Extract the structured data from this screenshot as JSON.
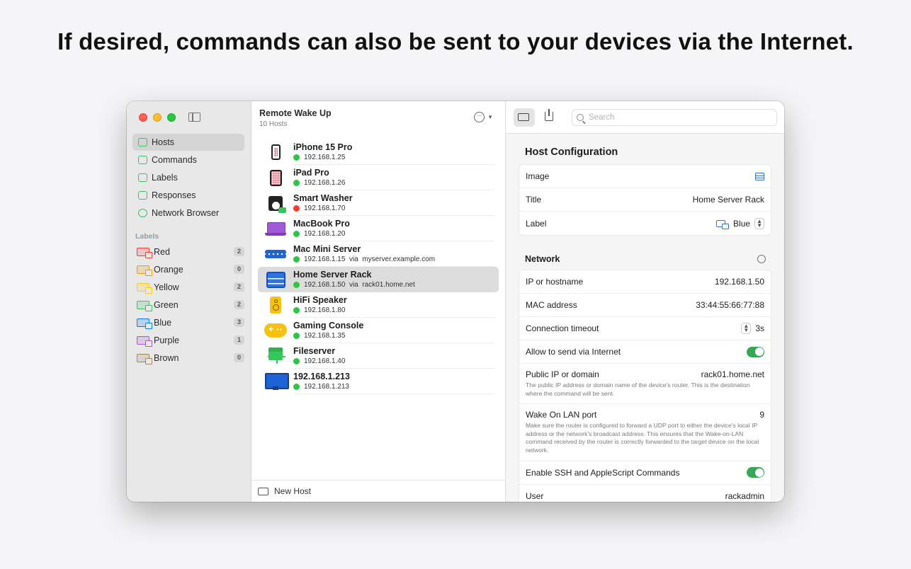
{
  "headline": "If desired, commands can also be sent to your devices via the Internet.",
  "sidebar": {
    "nav": [
      {
        "label": "Hosts",
        "active": true
      },
      {
        "label": "Commands"
      },
      {
        "label": "Labels"
      },
      {
        "label": "Responses"
      },
      {
        "label": "Network Browser"
      }
    ],
    "labels_heading": "Labels",
    "labels": [
      {
        "name": "Red",
        "count": "2",
        "color": "#ff3b30"
      },
      {
        "name": "Orange",
        "count": "0",
        "color": "#ff9500"
      },
      {
        "name": "Yellow",
        "count": "2",
        "color": "#ffcc00"
      },
      {
        "name": "Green",
        "count": "2",
        "color": "#34c759"
      },
      {
        "name": "Blue",
        "count": "3",
        "color": "#007aff"
      },
      {
        "name": "Purple",
        "count": "1",
        "color": "#af52de"
      },
      {
        "name": "Brown",
        "count": "0",
        "color": "#a2845e"
      }
    ]
  },
  "list": {
    "title": "Remote Wake Up",
    "subtitle": "10 Hosts",
    "hosts": [
      {
        "name": "iPhone 15 Pro",
        "addr": "192.168.1.25",
        "status": "#28c840",
        "icon": "phone-icon"
      },
      {
        "name": "iPad Pro",
        "addr": "192.168.1.26",
        "status": "#28c840",
        "icon": "ipad-icon"
      },
      {
        "name": "Smart Washer",
        "addr": "192.168.1.70",
        "status": "#ff3b30",
        "icon": "washer-icon"
      },
      {
        "name": "MacBook Pro",
        "addr": "192.168.1.20",
        "status": "#28c840",
        "icon": "macbook-icon"
      },
      {
        "name": "Mac Mini Server",
        "addr": "192.168.1.15  via  myserver.example.com",
        "status": "#28c840",
        "icon": "mac-mini-icon"
      },
      {
        "name": "Home Server Rack",
        "addr": "192.168.1.50  via  rack01.home.net",
        "status": "#28c840",
        "icon": "server-rack-icon",
        "selected": true
      },
      {
        "name": "HiFi Speaker",
        "addr": "192.168.1.80",
        "status": "#28c840",
        "icon": "speaker-icon"
      },
      {
        "name": "Gaming Console",
        "addr": "192.168.1.35",
        "status": "#28c840",
        "icon": "gamepad-icon"
      },
      {
        "name": "Fileserver",
        "addr": "192.168.1.40",
        "status": "#28c840",
        "icon": "network-tree-icon"
      },
      {
        "name": "192.168.1.213",
        "addr": "192.168.1.213",
        "status": "#28c840",
        "icon": "monitor-icon"
      }
    ],
    "new_host": "New Host"
  },
  "detail": {
    "search_placeholder": "Search",
    "config_title": "Host Configuration",
    "image_label": "Image",
    "title_label": "Title",
    "title_value": "Home Server Rack",
    "label_label": "Label",
    "label_value": "Blue",
    "network_title": "Network",
    "ip_label": "IP or hostname",
    "ip_value": "192.168.1.50",
    "mac_label": "MAC address",
    "mac_value": "33:44:55:66:77:88",
    "timeout_label": "Connection timeout",
    "timeout_value": "3s",
    "internet_label": "Allow to send via Internet",
    "public_label": "Public IP or domain",
    "public_value": "rack01.home.net",
    "public_help": "The public IP address or domain name of the device's router. This is the destination where the command will be sent.",
    "port_label": "Wake On LAN port",
    "port_value": "9",
    "port_help": "Make sure the router is configured to forward a UDP port to either the device's local IP address or the network's broadcast address. This ensures that the Wake-on-LAN command received by the router is correctly forwarded to the target device on the local network.",
    "ssh_label": "Enable SSH and AppleScript Commands",
    "user_label": "User",
    "user_value": "rackadmin"
  }
}
